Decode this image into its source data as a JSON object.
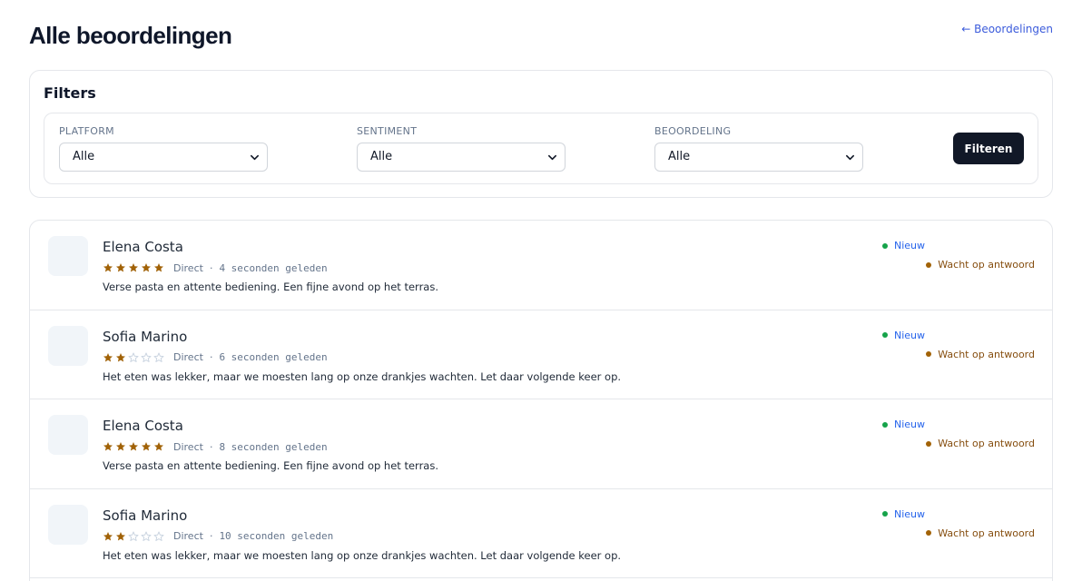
{
  "page": {
    "title": "Alle beoordelingen",
    "back_link": "← Beoordelingen"
  },
  "filters": {
    "title": "Filters",
    "platform": {
      "label": "PLATFORM",
      "value": "Alle"
    },
    "sentiment": {
      "label": "SENTIMENT",
      "value": "Alle"
    },
    "rating": {
      "label": "BEOORDELING",
      "value": "Alle"
    },
    "submit_label": "Filteren"
  },
  "colors": {
    "star_filled": "#a16207",
    "star_empty": "#cbd5e1",
    "badge_new_dot": "#16a34a",
    "badge_wait_dot": "#a16207",
    "primary_button": "#111827"
  },
  "icons": {
    "star": "star-icon",
    "chevron": "chevron-down-icon"
  },
  "reviews": [
    {
      "name": "Elena Costa",
      "rating": 5,
      "platform": "Direct",
      "separator": "·",
      "time": "4 seconden geleden",
      "text": "Verse pasta en attente bediening. Een fijne avond op het terras.",
      "status_new": "Nieuw",
      "status_reply": "Wacht op antwoord"
    },
    {
      "name": "Sofia Marino",
      "rating": 2,
      "platform": "Direct",
      "separator": "·",
      "time": "6 seconden geleden",
      "text": "Het eten was lekker, maar we moesten lang op onze drankjes wachten. Let daar volgende keer op.",
      "status_new": "Nieuw",
      "status_reply": "Wacht op antwoord"
    },
    {
      "name": "Elena Costa",
      "rating": 5,
      "platform": "Direct",
      "separator": "·",
      "time": "8 seconden geleden",
      "text": "Verse pasta en attente bediening. Een fijne avond op het terras.",
      "status_new": "Nieuw",
      "status_reply": "Wacht op antwoord"
    },
    {
      "name": "Sofia Marino",
      "rating": 2,
      "platform": "Direct",
      "separator": "·",
      "time": "10 seconden geleden",
      "text": "Het eten was lekker, maar we moesten lang op onze drankjes wachten. Let daar volgende keer op.",
      "status_new": "Nieuw",
      "status_reply": "Wacht op antwoord"
    }
  ]
}
